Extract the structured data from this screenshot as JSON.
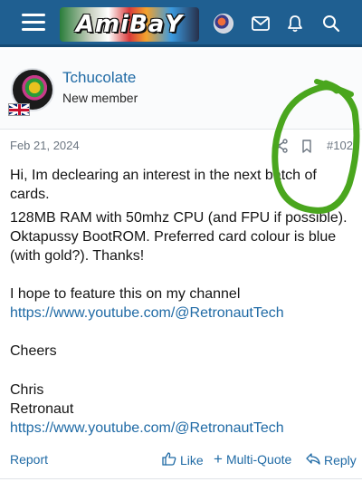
{
  "header": {
    "logo_text": "AmiBaY",
    "menu_icon": "hamburger-icon",
    "icons": [
      "avatar",
      "envelope-icon",
      "bell-icon",
      "search-icon"
    ],
    "bg_color": "#1f5f91"
  },
  "post": {
    "author": "Tchucolate",
    "user_title": "New member",
    "flag": "gb-flag-icon",
    "date": "Feb 21, 2024",
    "post_number": "#102",
    "body_lines": [
      "Hi, Im declearing an interest in the next batch of",
      "cards.",
      "128MB RAM with 50mhz CPU (and FPU if possible).",
      "Oktapussy BootROM. Preferred card colour is blue",
      "(with gold?). Thanks!",
      "",
      "I hope to feature this on my channel",
      "https://www.youtube.com/@RetronautTech",
      "",
      "Cheers",
      "",
      "Chris",
      "Retronaut",
      "https://www.youtube.com/@RetronautTech"
    ]
  },
  "actions": {
    "report": "Report",
    "like": "Like",
    "multiquote": "Multi-Quote",
    "reply": "Reply"
  },
  "colors": {
    "link": "#1f6aa5",
    "annotation": "#4aa61e"
  }
}
